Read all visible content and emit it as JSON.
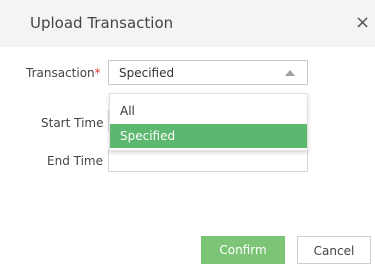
{
  "dialog": {
    "title": "Upload Transaction",
    "close_glyph": "×"
  },
  "form": {
    "transaction_label": "Transaction",
    "required_mark": "*",
    "transaction_value": "Specified",
    "start_time_label": "Start Time",
    "end_time_label": "End Time"
  },
  "dropdown": {
    "options": [
      "All",
      "Specified"
    ],
    "highlighted": "Specified"
  },
  "buttons": {
    "confirm": "Confirm",
    "cancel": "Cancel"
  },
  "colors": {
    "highlight": "#5cb76f",
    "confirm": "#7cc576",
    "required": "#e0382f"
  },
  "icons": {
    "close": "close-icon",
    "caret": "caret-up-icon"
  }
}
